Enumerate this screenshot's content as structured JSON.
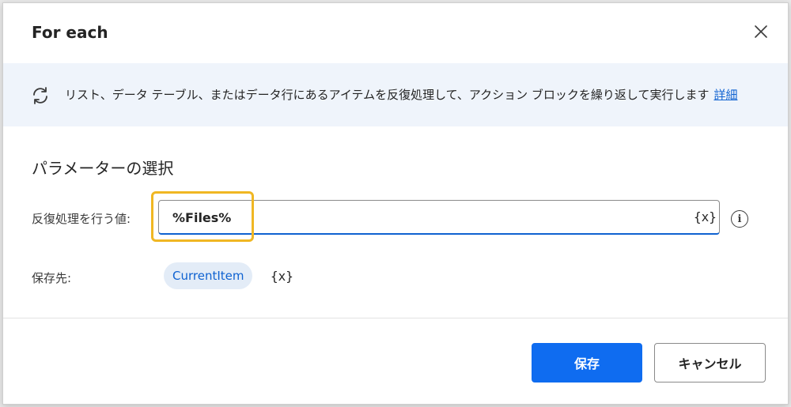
{
  "dialog": {
    "title": "For each"
  },
  "banner": {
    "icon": "loop-arrows-icon",
    "text": "リスト、データ テーブル、またはデータ行にあるアイテムを反復処理して、アクション ブロックを繰り返して実行します",
    "link_label": "詳細"
  },
  "parameters": {
    "section_title": "パラメーターの選択",
    "iterate": {
      "label": "反復処理を行う値:",
      "value": "%Files%",
      "var_picker": "{x}"
    },
    "store": {
      "label": "保存先:",
      "variable": "CurrentItem",
      "var_picker": "{x}"
    }
  },
  "buttons": {
    "save": "保存",
    "cancel": "キャンセル"
  },
  "colors": {
    "accent": "#0f6cf0",
    "link": "#0f62d1",
    "highlight": "#f0b723",
    "banner_bg": "#eff4fb",
    "chip_bg": "#e3ecf7"
  }
}
